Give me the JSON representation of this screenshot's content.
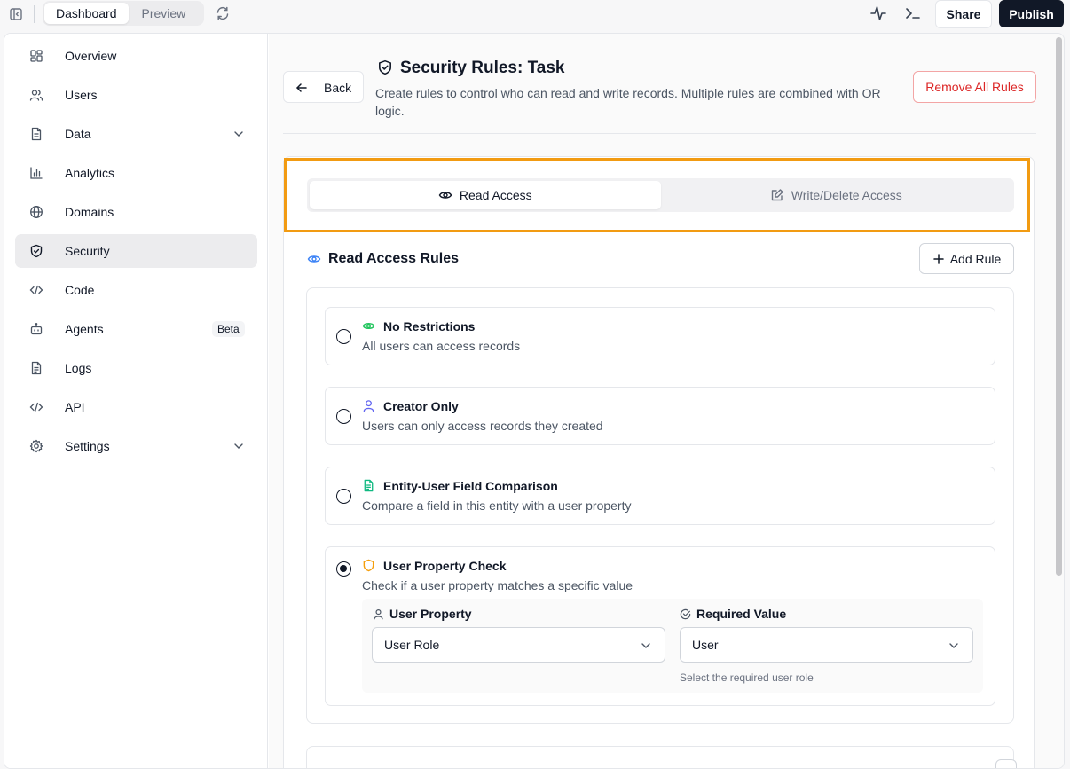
{
  "topbar": {
    "tabs": [
      {
        "label": "Dashboard",
        "active": true
      },
      {
        "label": "Preview",
        "active": false
      }
    ],
    "share_label": "Share",
    "publish_label": "Publish"
  },
  "sidebar": {
    "items": [
      {
        "label": "Overview",
        "icon": "layout-grid-icon"
      },
      {
        "label": "Users",
        "icon": "users-icon"
      },
      {
        "label": "Data",
        "icon": "file-icon",
        "expandable": true
      },
      {
        "label": "Analytics",
        "icon": "bar-chart-icon"
      },
      {
        "label": "Domains",
        "icon": "globe-icon"
      },
      {
        "label": "Security",
        "icon": "shield-icon",
        "active": true
      },
      {
        "label": "Code",
        "icon": "code-icon"
      },
      {
        "label": "Agents",
        "icon": "bot-icon",
        "badge": "Beta"
      },
      {
        "label": "Logs",
        "icon": "file-text-icon"
      },
      {
        "label": "API",
        "icon": "code-icon"
      },
      {
        "label": "Settings",
        "icon": "gear-icon",
        "expandable": true
      }
    ]
  },
  "page": {
    "back_label": "Back",
    "title": "Security Rules: Task",
    "description": "Create rules to control who can read and write records. Multiple rules are combined with OR logic.",
    "remove_all_label": "Remove All Rules"
  },
  "access_tabs": [
    {
      "label": "Read Access",
      "icon": "eye-icon",
      "active": true
    },
    {
      "label": "Write/Delete Access",
      "icon": "edit-icon",
      "active": false
    }
  ],
  "rules_section": {
    "title": "Read Access Rules",
    "add_rule_label": "Add Rule",
    "rules": [
      {
        "title": "No Restrictions",
        "description": "All users can access records",
        "icon": "eye-icon",
        "icon_color": "#22c55e",
        "selected": false
      },
      {
        "title": "Creator Only",
        "description": "Users can only access records they created",
        "icon": "user-icon",
        "icon_color": "#6366f1",
        "selected": false
      },
      {
        "title": "Entity-User Field Comparison",
        "description": "Compare a field in this entity with a user property",
        "icon": "file-text-icon",
        "icon_color": "#10b981",
        "selected": false
      },
      {
        "title": "User Property Check",
        "description": "Check if a user property matches a specific value",
        "icon": "shield-icon",
        "icon_color": "#f59e0b",
        "selected": true
      }
    ],
    "user_property": {
      "label": "User Property",
      "value": "User Role"
    },
    "required_value": {
      "label": "Required Value",
      "value": "User",
      "hint": "Select the required user role"
    }
  },
  "colors": {
    "accent_highlight": "#f29b12",
    "danger": "#dc2626",
    "primary_dark": "#111827"
  }
}
